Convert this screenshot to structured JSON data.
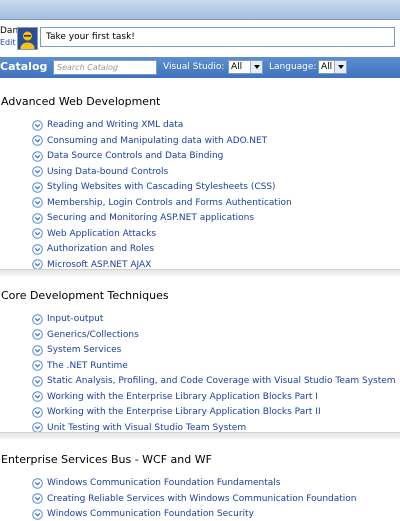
{
  "user": {
    "name": "Dan",
    "edit": "Edit"
  },
  "task": {
    "text": "Take your first task!"
  },
  "catalog": {
    "title": "Catalog",
    "search_placeholder": "Search Catalog",
    "visual_studio_label": "Visual Studio:",
    "visual_studio_value": "All",
    "language_label": "Language:",
    "language_value": "All"
  },
  "sections": [
    {
      "title": "Advanced Web Development",
      "items": [
        "Reading and Writing XML data",
        "Consuming and Manipulating data with ADO.NET",
        "Data Source Controls and Data Binding",
        "Using Data-bound Controls",
        "Styling Websites with Cascading Stylesheets (CSS)",
        "Membership, Login Controls and Forms Authentication",
        "Securing and Monitoring ASP.NET applications",
        "Web Application Attacks",
        "Authorization and Roles",
        "Microsoft ASP.NET AJAX"
      ]
    },
    {
      "title": "Core Development Techniques",
      "items": [
        "Input-output",
        "Generics/Collections",
        "System Services",
        "The .NET Runtime",
        "Static Analysis, Profiling, and Code Coverage with Visual Studio Team System",
        "Working with the Enterprise Library Application Blocks Part I",
        "Working with the Enterprise Library Application Blocks Part II",
        "Unit Testing with Visual Studio Team System"
      ]
    },
    {
      "title": "Enterprise Services Bus - WCF and WF",
      "items": [
        "Windows Communication Foundation Fundamentals",
        "Creating Reliable Services with Windows Communication Foundation",
        "Windows Communication Foundation Security"
      ]
    }
  ],
  "colors": {
    "catalog_bar": "#4a7cc6",
    "link": "#1a3fa0",
    "chevron": "#5a8fd6"
  }
}
